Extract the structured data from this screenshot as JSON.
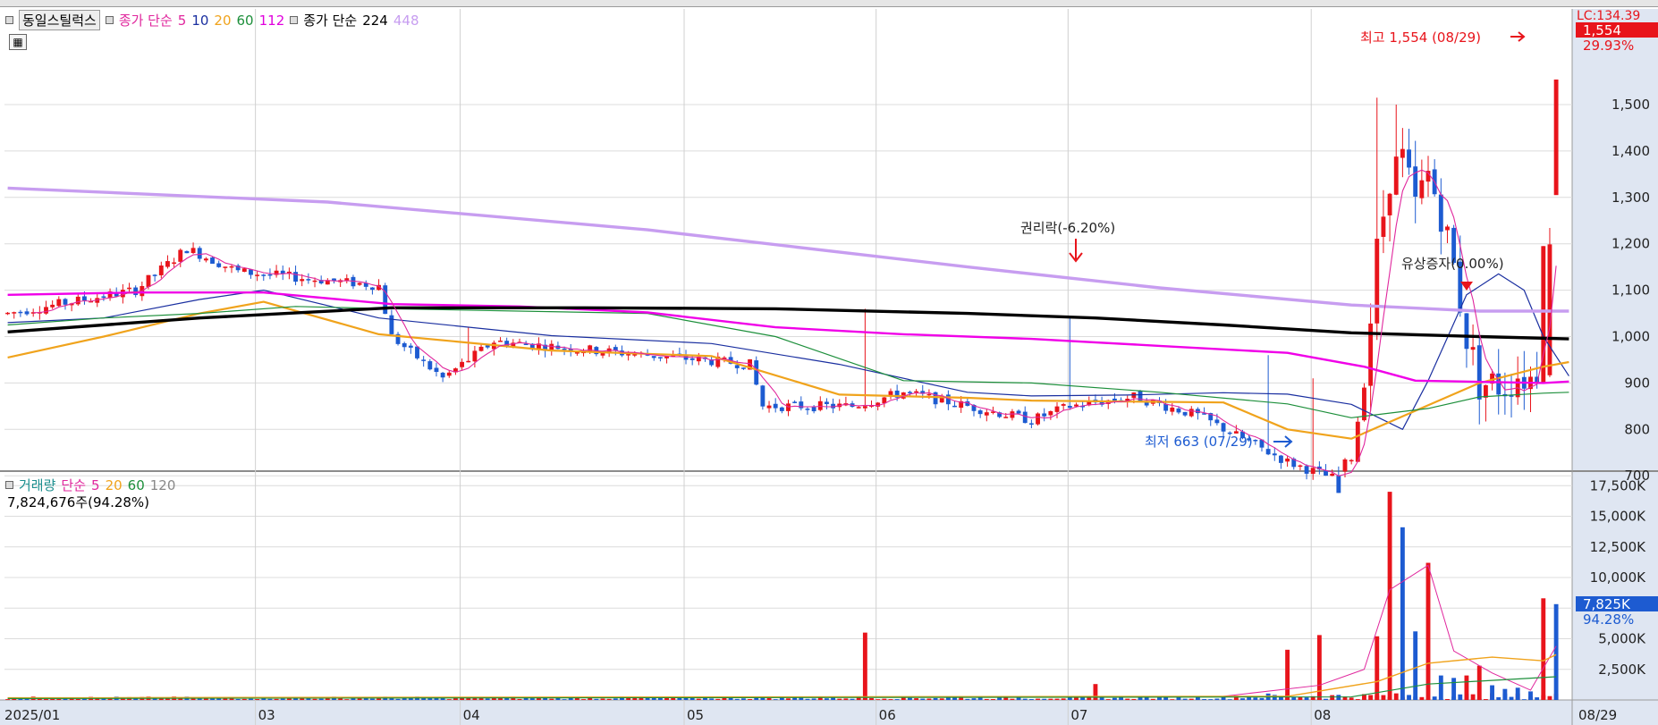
{
  "price_legend": {
    "symbol": "동일스틸럭스",
    "ma_label": "종가 단순",
    "periods": [
      "5",
      "10",
      "20",
      "60",
      "112"
    ],
    "ma_label2": "종가 단순",
    "periods2": [
      "224",
      "448"
    ]
  },
  "volume_legend": {
    "label": "거래량",
    "ma_label": "단순",
    "periods": [
      "5",
      "20",
      "60",
      "120"
    ],
    "current": "7,824,676주(94.28%)"
  },
  "annotations": {
    "high": "최고 1,554 (08/29)",
    "low": "최저 663 (07/29)",
    "rights": "권리락(-6.20%)",
    "capital": "유상증자(0.00%)"
  },
  "price_scale_box": {
    "top": "LC:134.39",
    "price": "1,554",
    "pct": "29.93%"
  },
  "volume_scale_box": {
    "value": "7,825K",
    "pct": "94.28%"
  },
  "colors": {
    "up": "#e8141b",
    "down": "#1d5bd1",
    "ma5": "#e0279d",
    "ma10": "#1a2fa0",
    "ma20": "#f0a31c",
    "ma60": "#1d8f3b",
    "ma112": "#f000e8",
    "ma224": "#000000",
    "ma448": "#c79df0",
    "legend5": "#e0279d",
    "legend10": "#1a2fa0",
    "legend20": "#f0a31c",
    "legend60": "#1d8f3b",
    "legend112": "#e000dd",
    "legend448": "#c79df0",
    "vol_label": "#1d8f8f"
  },
  "chart_data": [
    {
      "type": "candlestick",
      "title": "동일스틸럭스",
      "x_labels": [
        "2025/01",
        "03",
        "04",
        "05",
        "06",
        "07",
        "08",
        "08/29"
      ],
      "y_ticks": [
        "1,500",
        "1,400",
        "1,300",
        "1,200",
        "1,100",
        "1,000",
        "900",
        "800",
        "700"
      ],
      "ylim": [
        610,
        1590
      ],
      "grid": true,
      "series": [
        {
          "name": "10",
          "values": [
            [
              0,
              1030
            ],
            [
              15,
              1040
            ],
            [
              30,
              1080
            ],
            [
              40,
              1100
            ],
            [
              58,
              1040
            ],
            [
              85,
              1002
            ],
            [
              110,
              985
            ],
            [
              130,
              940
            ],
            [
              150,
              880
            ],
            [
              160,
              872
            ],
            [
              175,
              874
            ],
            [
              190,
              879
            ],
            [
              200,
              876
            ],
            [
              210,
              854
            ],
            [
              218,
              800
            ],
            [
              222,
              905
            ],
            [
              228,
              1090
            ],
            [
              233,
              1135
            ],
            [
              237,
              1100
            ],
            [
              240,
              1000
            ],
            [
              244,
              915
            ]
          ]
        },
        {
          "name": "20",
          "values": [
            [
              0,
              955
            ],
            [
              15,
              1000
            ],
            [
              30,
              1050
            ],
            [
              40,
              1075
            ],
            [
              58,
              1005
            ],
            [
              85,
              970
            ],
            [
              110,
              958
            ],
            [
              130,
              875
            ],
            [
              150,
              868
            ],
            [
              160,
              862
            ],
            [
              175,
              860
            ],
            [
              190,
              858
            ],
            [
              200,
              800
            ],
            [
              210,
              780
            ],
            [
              220,
              840
            ],
            [
              230,
              900
            ],
            [
              240,
              935
            ],
            [
              244,
              945
            ]
          ]
        },
        {
          "name": "60",
          "values": [
            [
              0,
              1025
            ],
            [
              15,
              1040
            ],
            [
              30,
              1050
            ],
            [
              45,
              1065
            ],
            [
              60,
              1060
            ],
            [
              80,
              1055
            ],
            [
              100,
              1050
            ],
            [
              120,
              1000
            ],
            [
              140,
              905
            ],
            [
              160,
              900
            ],
            [
              180,
              880
            ],
            [
              200,
              855
            ],
            [
              210,
              825
            ],
            [
              222,
              845
            ],
            [
              230,
              870
            ],
            [
              240,
              878
            ],
            [
              244,
              880
            ]
          ]
        },
        {
          "name": "112",
          "values": [
            [
              0,
              1090
            ],
            [
              20,
              1095
            ],
            [
              40,
              1095
            ],
            [
              60,
              1070
            ],
            [
              80,
              1065
            ],
            [
              100,
              1052
            ],
            [
              120,
              1020
            ],
            [
              140,
              1005
            ],
            [
              160,
              995
            ],
            [
              180,
              980
            ],
            [
              200,
              965
            ],
            [
              212,
              935
            ],
            [
              220,
              905
            ],
            [
              240,
              900
            ],
            [
              244,
              903
            ]
          ]
        },
        {
          "name": "224",
          "values": [
            [
              0,
              1010
            ],
            [
              30,
              1040
            ],
            [
              60,
              1062
            ],
            [
              90,
              1062
            ],
            [
              120,
              1060
            ],
            [
              150,
              1050
            ],
            [
              170,
              1040
            ],
            [
              190,
              1025
            ],
            [
              210,
              1008
            ],
            [
              230,
              1000
            ],
            [
              244,
              995
            ]
          ]
        },
        {
          "name": "448",
          "values": [
            [
              0,
              1320
            ],
            [
              50,
              1290
            ],
            [
              100,
              1230
            ],
            [
              150,
              1150
            ],
            [
              180,
              1105
            ],
            [
              210,
              1068
            ],
            [
              230,
              1055
            ],
            [
              244,
              1055
            ]
          ]
        }
      ]
    },
    {
      "type": "bar",
      "title": "거래량",
      "y_ticks": [
        "17,500K",
        "15,000K",
        "12,500K",
        "10,000K",
        "7,500K",
        "5,000K",
        "2,500K"
      ],
      "ylim": [
        0,
        18500
      ],
      "grid": true,
      "values": [
        [
          134,
          5500,
          "up"
        ],
        [
          170,
          1300,
          "up"
        ],
        [
          200,
          4100,
          "up"
        ],
        [
          205,
          5300,
          "up"
        ],
        [
          214,
          5200,
          "up"
        ],
        [
          216,
          17000,
          "up"
        ],
        [
          218,
          14100,
          "down"
        ],
        [
          220,
          5600,
          "down"
        ],
        [
          222,
          11200,
          "up"
        ],
        [
          224,
          2000,
          "down"
        ],
        [
          226,
          1800,
          "down"
        ],
        [
          228,
          2000,
          "up"
        ],
        [
          230,
          2800,
          "up"
        ],
        [
          232,
          1200,
          "down"
        ],
        [
          234,
          900,
          "down"
        ],
        [
          236,
          1000,
          "down"
        ],
        [
          238,
          700,
          "down"
        ],
        [
          240,
          8300,
          "up"
        ],
        [
          242,
          7825,
          "down"
        ]
      ]
    }
  ]
}
